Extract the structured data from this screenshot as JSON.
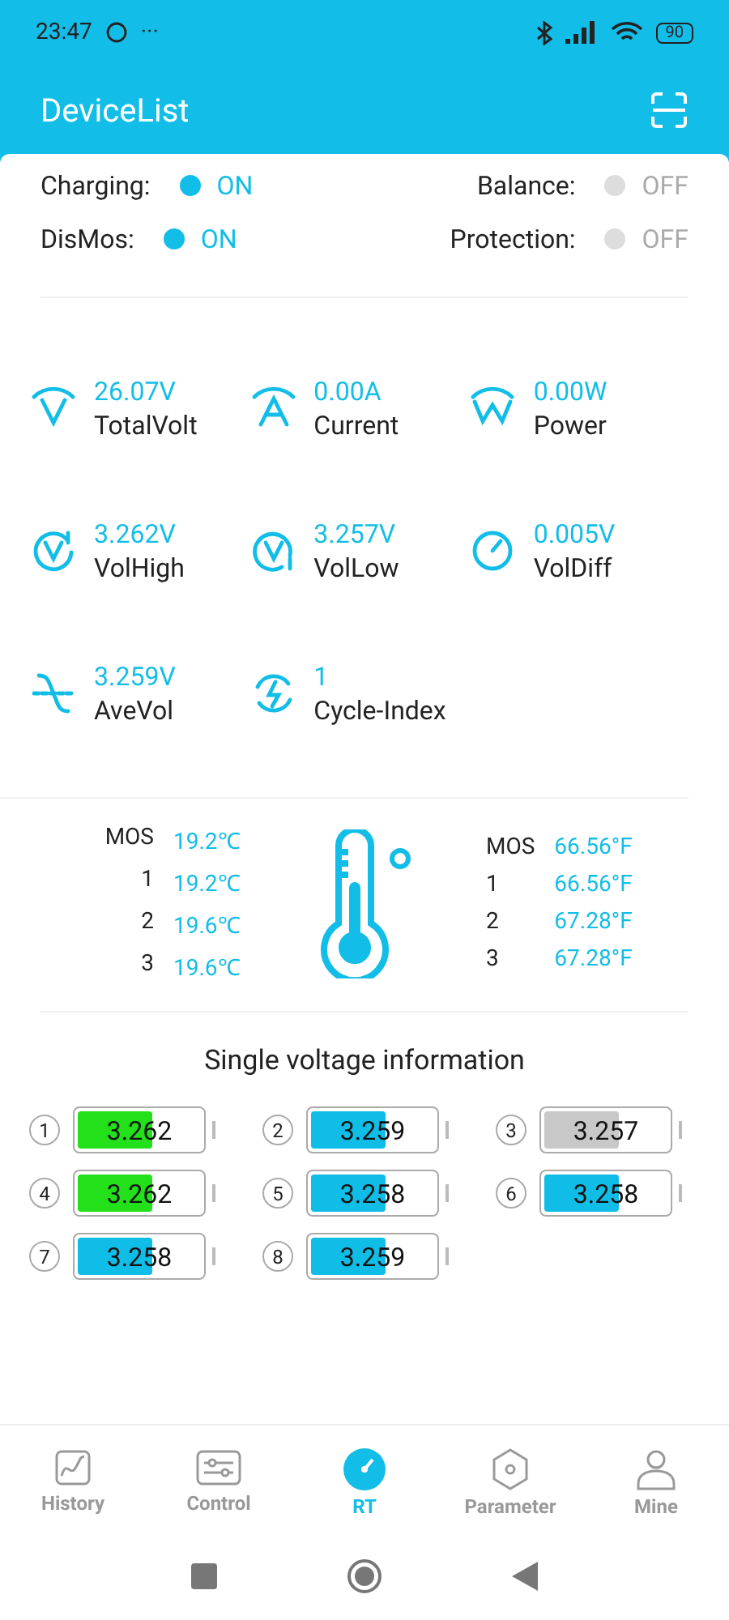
{
  "status_bar": {
    "time": "23:47",
    "more": "···",
    "battery": "90"
  },
  "app_bar": {
    "title": "DeviceList"
  },
  "switches": [
    {
      "label": "Charging:",
      "value": "ON",
      "on": true
    },
    {
      "label": "Balance:",
      "value": "OFF",
      "on": false
    },
    {
      "label": "DisMos:",
      "value": "ON",
      "on": true
    },
    {
      "label": "Protection:",
      "value": "OFF",
      "on": false
    }
  ],
  "metrics": [
    {
      "value": "26.07V",
      "label": "TotalVolt"
    },
    {
      "value": "0.00A",
      "label": "Current"
    },
    {
      "value": "0.00W",
      "label": "Power"
    },
    {
      "value": "3.262V",
      "label": "VolHigh"
    },
    {
      "value": "3.257V",
      "label": "VolLow"
    },
    {
      "value": "0.005V",
      "label": "VolDiff"
    },
    {
      "value": "3.259V",
      "label": "AveVol"
    },
    {
      "value": "1",
      "label": "Cycle-Index"
    }
  ],
  "temperatures": {
    "celsius": [
      {
        "label": "MOS",
        "value": "19.2℃"
      },
      {
        "label": "1",
        "value": "19.2℃"
      },
      {
        "label": "2",
        "value": "19.6℃"
      },
      {
        "label": "3",
        "value": "19.6℃"
      }
    ],
    "fahrenheit": [
      {
        "label": "MOS",
        "value": "66.56°F"
      },
      {
        "label": "1",
        "value": "66.56°F"
      },
      {
        "label": "2",
        "value": "67.28°F"
      },
      {
        "label": "3",
        "value": "67.28°F"
      }
    ]
  },
  "cells_title": "Single voltage information",
  "cells": [
    {
      "index": "1",
      "value": "3.262",
      "level": 0.6,
      "color": "#22e01a"
    },
    {
      "index": "2",
      "value": "3.259",
      "level": 0.6,
      "color": "#0fbde6"
    },
    {
      "index": "3",
      "value": "3.257",
      "level": 0.6,
      "color": "#c8c8c8"
    },
    {
      "index": "4",
      "value": "3.262",
      "level": 0.6,
      "color": "#22e01a"
    },
    {
      "index": "5",
      "value": "3.258",
      "level": 0.6,
      "color": "#0fbde6"
    },
    {
      "index": "6",
      "value": "3.258",
      "level": 0.6,
      "color": "#0fbde6"
    },
    {
      "index": "7",
      "value": "3.258",
      "level": 0.6,
      "color": "#0fbde6"
    },
    {
      "index": "8",
      "value": "3.259",
      "level": 0.6,
      "color": "#0fbde6"
    }
  ],
  "tabs": [
    {
      "label": "History",
      "selected": false
    },
    {
      "label": "Control",
      "selected": false
    },
    {
      "label": "RT",
      "selected": true
    },
    {
      "label": "Parameter",
      "selected": false
    },
    {
      "label": "Mine",
      "selected": false
    }
  ]
}
